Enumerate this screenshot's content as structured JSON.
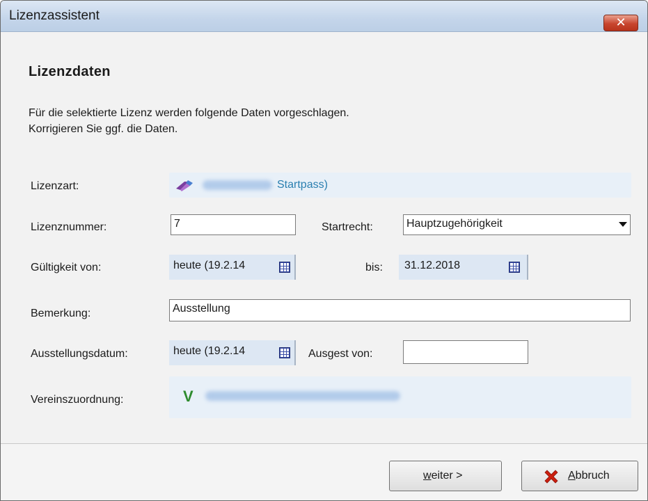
{
  "window": {
    "title": "Lizenzassistent",
    "close_glyph": "✕"
  },
  "page": {
    "heading": "Lizenzdaten",
    "description_line1": "Für die selektierte Lizenz werden folgende Daten vorgeschlagen.",
    "description_line2": "Korrigieren Sie ggf. die Daten."
  },
  "form": {
    "lizenzart": {
      "label": "Lizenzart:",
      "icon": "license-pen-icon",
      "value_text": "Startpass)"
    },
    "lizenznummer": {
      "label": "Lizenznummer:",
      "value": "7"
    },
    "startrecht": {
      "label": "Startrecht:",
      "selected": "Hauptzugehörigkeit"
    },
    "gueltigkeit_von": {
      "label": "Gültigkeit von:",
      "value": "heute (19.2.14"
    },
    "gueltigkeit_bis": {
      "label": "bis:",
      "value": "31.12.2018"
    },
    "bemerkung": {
      "label": "Bemerkung:",
      "value": "Ausstellung"
    },
    "ausstellungsdatum": {
      "label": "Ausstellungsdatum:",
      "value": "heute (19.2.14"
    },
    "ausgestellt_von": {
      "label": "Ausgest von:",
      "value": ""
    },
    "vereinszuordnung": {
      "label": "Vereinszuordnung:",
      "marker": "V"
    }
  },
  "footer": {
    "next_button": {
      "accel": "w",
      "rest": "eiter >"
    },
    "cancel_button": {
      "accel": "A",
      "rest": "bbruch"
    }
  },
  "colors": {
    "accent_link": "#2a7fb0",
    "readonly_bg": "#e8f0f8",
    "cancel_icon": "#cc1f0f",
    "vereins_marker": "#2e8b2e"
  }
}
